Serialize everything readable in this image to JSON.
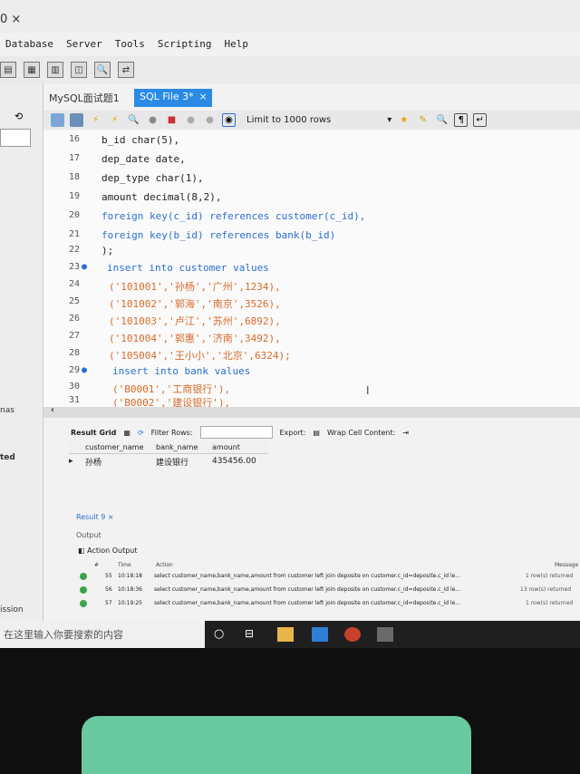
{
  "titlebar": {
    "app_fragment": "0  ×"
  },
  "menu": {
    "items": [
      "Database",
      "Server",
      "Tools",
      "Scripting",
      "Help"
    ]
  },
  "tabs": {
    "tab1": "MySQL面试题1",
    "tab2": "SQL File 3*",
    "tab2_close": "×"
  },
  "editor_toolbar": {
    "limit_label": "Limit to 1000 rows"
  },
  "sql_lines": [
    {
      "n": "16",
      "code": "b_id char(5),"
    },
    {
      "n": "17",
      "code": "dep_date date,"
    },
    {
      "n": "18",
      "code": "dep_type char(1),"
    },
    {
      "n": "19",
      "code": "amount decimal(8,2),"
    },
    {
      "n": "20",
      "code": "foreign key(c_id) references customer(c_id),"
    },
    {
      "n": "21",
      "code": "foreign key(b_id) references bank(b_id)"
    },
    {
      "n": "22",
      "code": ");"
    },
    {
      "n": "23",
      "code": "insert into customer values",
      "dot": "●"
    },
    {
      "n": "24",
      "code": "('101001','孙杨','广州',1234),"
    },
    {
      "n": "25",
      "code": "('101002','郭海','南京',3526),"
    },
    {
      "n": "26",
      "code": "('101003','卢江','苏州',6892),"
    },
    {
      "n": "27",
      "code": "('101004','郭惠','济南',3492),"
    },
    {
      "n": "28",
      "code": "('105004','王小小','北京',6324);"
    },
    {
      "n": "29",
      "code": "insert into bank values",
      "dot": "●"
    },
    {
      "n": "30",
      "code": "('B0001','工商银行'),"
    },
    {
      "n": "31",
      "code": "('B0002','建设银行'),"
    }
  ],
  "result_toolbar": {
    "result_grid": "Result Grid",
    "filter_rows": "Filter Rows:",
    "export": "Export:",
    "wrap_cell": "Wrap Cell Content:"
  },
  "grid": {
    "columns": [
      "customer_name",
      "bank_name",
      "amount"
    ],
    "rows": [
      [
        "孙杨",
        "建设银行",
        "435456.00"
      ]
    ]
  },
  "output": {
    "result_tab": "Result 9  ×",
    "output_label": "Output",
    "action_output": "Action Output",
    "headers": {
      "hash": "#",
      "time": "Time",
      "action": "Action",
      "message": "Message"
    },
    "rows": [
      {
        "n": "55",
        "time": "10:18:18",
        "action": "select customer_name,bank_name,amount  from customer  left join deposite on customer.c_id=deposite.c_id le...",
        "msg": "1 row(s) returned"
      },
      {
        "n": "56",
        "time": "10:18:36",
        "action": "select customer_name,bank_name,amount  from customer  left join deposite on customer.c_id=deposite.c_id le...",
        "msg": "13 row(s) returned"
      },
      {
        "n": "57",
        "time": "10:19:25",
        "action": "select customer_name,bank_name,amount  from customer  left join deposite on customer.c_id=deposite.c_id le...",
        "msg": "1 row(s) returned"
      }
    ]
  },
  "sidebar": {
    "label_nas": "nas",
    "label_ted": "ted",
    "label_ission": "ission"
  },
  "taskbar": {
    "search_placeholder": "在这里输入你要搜索的内容"
  }
}
